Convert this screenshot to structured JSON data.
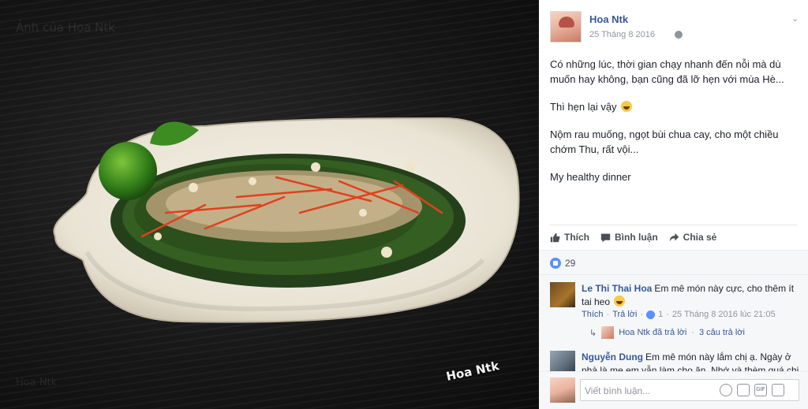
{
  "photo": {
    "watermark_top": "Ảnh của Hoa Ntk",
    "watermark_bottom": "Hoa Ntk",
    "signature": "Hoa Ntk"
  },
  "post": {
    "author": "Hoa Ntk",
    "date": "25 Tháng 8 2016",
    "privacy_icon": "globe-icon",
    "menu_icon": "chevron-down-icon",
    "body": [
      "Có những lúc, thời gian chạy nhanh đến nỗi mà dù muốn hay không, bạn cũng đã lỡ hẹn với mùa Hè...",
      "Thì hẹn lại vậy",
      "Nộm rau muống, ngọt bùi chua cay, cho một chiều chớm Thu, rất vội...",
      "My healthy dinner"
    ]
  },
  "actions": {
    "like": "Thích",
    "comment": "Bình luận",
    "share": "Chia sẻ"
  },
  "reactions": {
    "count": "29"
  },
  "comments": [
    {
      "author": "Le Thi Thai Hoa",
      "text": "Em mê món này cực, cho thêm ít tai heo",
      "like_label": "Thích",
      "reply_label": "Trả lời",
      "likes": "1",
      "time": "25 Tháng 8 2016 lúc 21:05",
      "reply_summary_author": "Hoa Ntk đã trả lời",
      "reply_summary_count": "3 câu trả lời"
    },
    {
      "author": "Nguyễn Dung",
      "text": "Em mê món này lắm chị ạ. Ngày ở nhà là mẹ em vẫn làm cho ăn. Nhớ và thèm quá chị"
    }
  ],
  "compose": {
    "placeholder": "Viết bình luận...",
    "icons": [
      "emoji-icon",
      "camera-icon",
      "gif-icon",
      "sticker-icon"
    ]
  },
  "colors": {
    "link": "#365899",
    "meta": "#90949c",
    "text": "#1d2129",
    "like_badge": "#5890ff"
  }
}
